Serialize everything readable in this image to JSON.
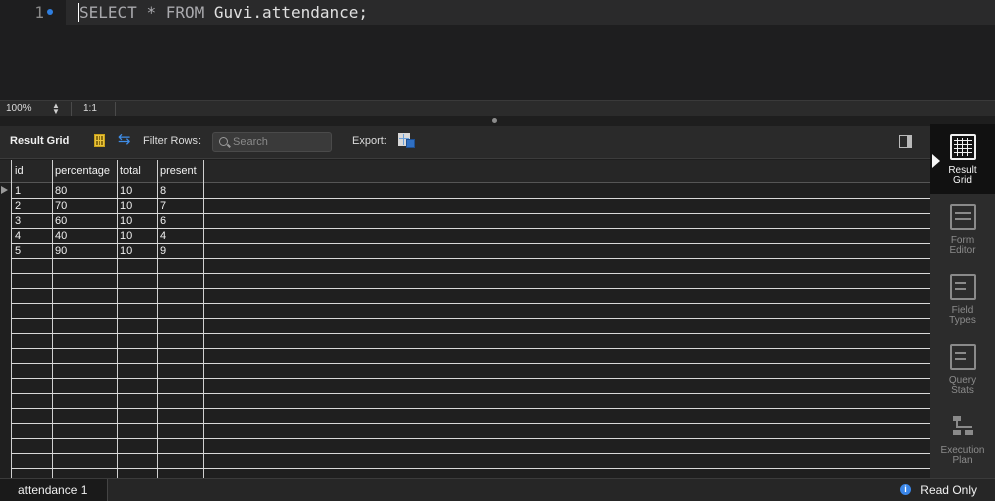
{
  "editor": {
    "line_number": "1",
    "query_keyword1": "SELECT",
    "query_star": "*",
    "query_keyword2": "FROM",
    "query_table": "Guvi.attendance;"
  },
  "zoombar": {
    "zoom": "100%",
    "ratio": "1:1"
  },
  "toolbar": {
    "title": "Result Grid",
    "filter_label": "Filter Rows:",
    "search_placeholder": "Search",
    "export_label": "Export:"
  },
  "grid": {
    "columns": [
      "id",
      "percentage",
      "total",
      "present"
    ],
    "rows": [
      [
        "1",
        "80",
        "10",
        "8"
      ],
      [
        "2",
        "70",
        "10",
        "7"
      ],
      [
        "3",
        "60",
        "10",
        "6"
      ],
      [
        "4",
        "40",
        "10",
        "4"
      ],
      [
        "5",
        "90",
        "10",
        "9"
      ]
    ]
  },
  "side_panel": {
    "items": [
      {
        "line1": "Result",
        "line2": "Grid",
        "icon": "result-grid-icon",
        "active": true
      },
      {
        "line1": "Form",
        "line2": "Editor",
        "icon": "form-editor-icon",
        "active": false
      },
      {
        "line1": "Field",
        "line2": "Types",
        "icon": "field-types-icon",
        "active": false
      },
      {
        "line1": "Query",
        "line2": "Stats",
        "icon": "query-stats-icon",
        "active": false
      },
      {
        "line1": "Execution",
        "line2": "Plan",
        "icon": "execution-plan-icon",
        "active": false
      }
    ]
  },
  "bottom": {
    "tab_label": "attendance 1",
    "status": "Read Only"
  },
  "colors": {
    "accent_blue": "#2f7fe0",
    "background": "#1e1e1e",
    "grid_line": "#d8d8d8"
  }
}
